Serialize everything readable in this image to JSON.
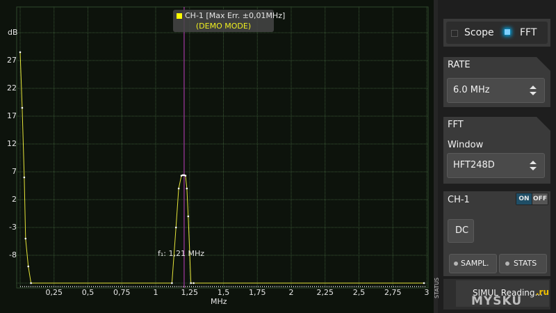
{
  "plot": {
    "y_unit": "dB",
    "x_unit": "MHz",
    "y_ticks": [
      "27",
      "22",
      "17",
      "12",
      "7",
      "2",
      "-3",
      "-8"
    ],
    "x_ticks": [
      "0,25",
      "0,5",
      "0,75",
      "1",
      "1,25",
      "1,5",
      "1,75",
      "2",
      "2,25",
      "2,5",
      "2,75",
      "3"
    ],
    "legend_line1": "CH-1 [Max Err. ±0,01MHz]",
    "legend_line2": "(DEMO MODE)",
    "marker_label": "f₁: 1,21 MHz"
  },
  "chart_data": {
    "type": "line",
    "xlabel": "MHz",
    "ylabel": "dB",
    "xlim": [
      0,
      3
    ],
    "ylim": [
      -13,
      32
    ],
    "series": [
      {
        "color": "#e6e63a",
        "x": [
          0.0,
          0.015,
          0.03,
          0.04,
          0.06,
          0.08,
          1.12,
          1.15,
          1.17,
          1.19,
          1.2,
          1.21,
          1.22,
          1.23,
          1.24,
          1.26,
          1.28,
          2.98
        ],
        "y": [
          28.5,
          18.5,
          6,
          -5,
          -10,
          -13,
          -13,
          -3,
          4,
          6.3,
          6.4,
          6.4,
          6.3,
          4,
          -1,
          -13,
          -13,
          -13
        ]
      }
    ],
    "cursor_x": 1.21,
    "grid": true
  },
  "panel": {
    "mode_scope": "Scope",
    "mode_fft": "FFT",
    "rate_title": "RATE",
    "rate_value": "6.0 MHz",
    "fft_title": "FFT",
    "window_label": "Window",
    "window_value": "HFT248D",
    "ch_title": "CH-1",
    "toggle_on": "ON",
    "toggle_off": "OFF",
    "dc_label": "DC",
    "sampl_label": "SAMPL.",
    "stats_label": "STATS",
    "status_side": "STATUS",
    "status_text": "SIMUL Reading...",
    "watermark": "MYSKU",
    "watermark_suffix": ".ru"
  },
  "colors": {
    "accent": "#00a8e8",
    "trace": "#e6e63a",
    "cursor": "#c040c0",
    "grid": "#3c5a36"
  }
}
